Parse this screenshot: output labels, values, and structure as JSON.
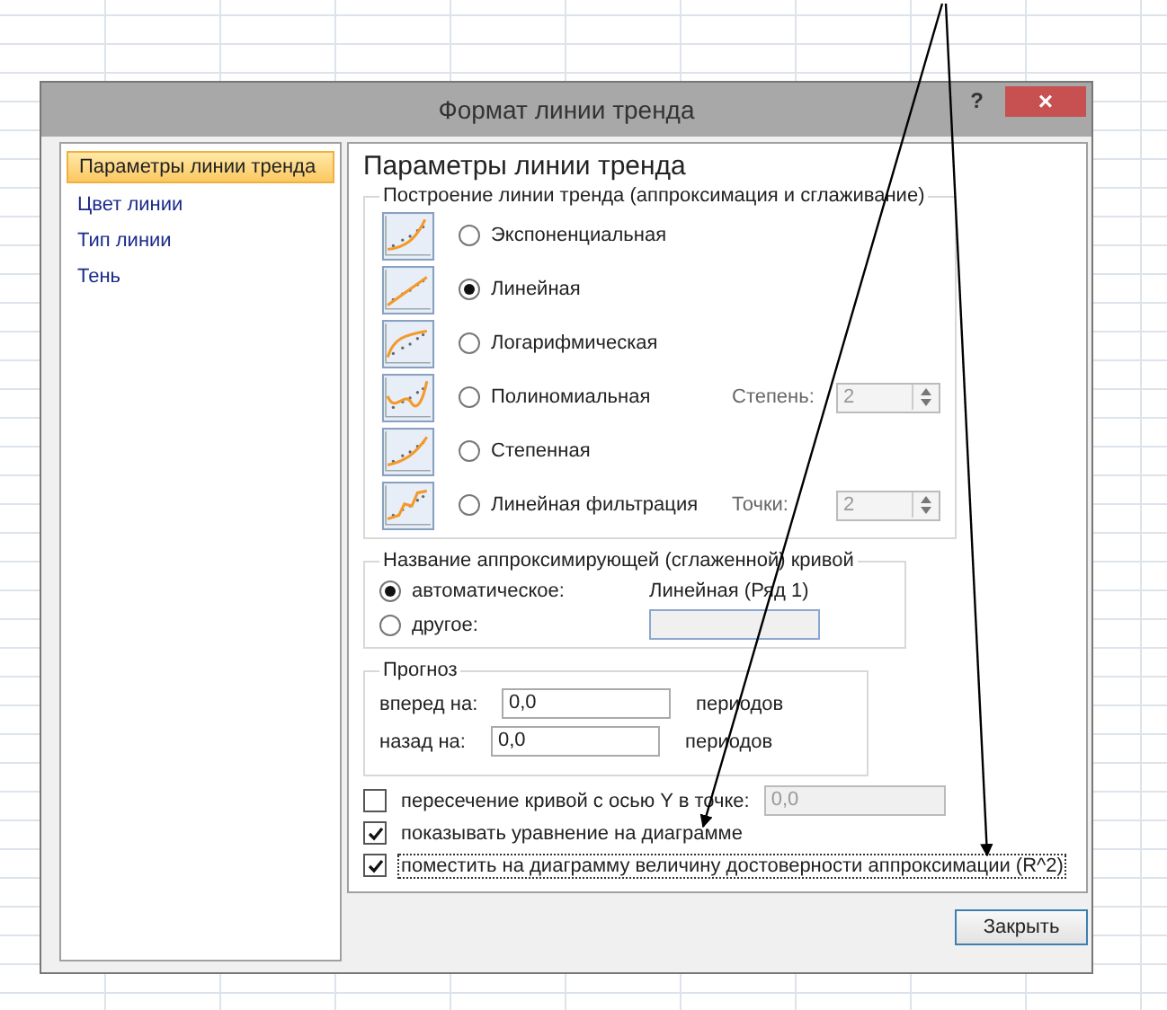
{
  "window": {
    "title": "Формат линии тренда",
    "help": "?",
    "close": "×"
  },
  "sidebar": {
    "items": [
      {
        "label": "Параметры линии тренда",
        "selected": true
      },
      {
        "label": "Цвет линии",
        "selected": false
      },
      {
        "label": "Тип линии",
        "selected": false
      },
      {
        "label": "Тень",
        "selected": false
      }
    ]
  },
  "heading": "Параметры линии тренда",
  "trend_group": {
    "title": "Построение линии тренда (аппроксимация и сглаживание)",
    "types": [
      {
        "kind": "exponential",
        "label": "Экспоненциальная",
        "selected": false
      },
      {
        "kind": "linear",
        "label": "Линейная",
        "selected": true
      },
      {
        "kind": "logarithmic",
        "label": "Логарифмическая",
        "selected": false
      },
      {
        "kind": "polynomial",
        "label": "Полиномиальная",
        "selected": false,
        "param_label": "Степень:",
        "param_value": "2"
      },
      {
        "kind": "power",
        "label": "Степенная",
        "selected": false
      },
      {
        "kind": "moving_average",
        "label": "Линейная фильтрация",
        "selected": false,
        "param_label": "Точки:",
        "param_value": "2"
      }
    ]
  },
  "name_group": {
    "title": "Название аппроксимирующей (сглаженной) кривой",
    "options": [
      {
        "label": "автоматическое:",
        "selected": true
      },
      {
        "label": "другое:",
        "selected": false
      }
    ],
    "auto_name": "Линейная (Ряд 1)"
  },
  "forecast": {
    "title": "Прогноз",
    "rows": [
      {
        "label": "вперед на:",
        "value": "0,0",
        "unit": "периодов"
      },
      {
        "label": "назад на:",
        "value": "0,0",
        "unit": "периодов"
      }
    ]
  },
  "options": [
    {
      "label": "пересечение кривой с осью Y в точке:",
      "checked": false,
      "value": "0,0",
      "disabled": true
    },
    {
      "label": "показывать уравнение на диаграмме",
      "checked": true
    },
    {
      "label": "поместить на диаграмму величину достоверности аппроксимации (R^2)",
      "checked": true,
      "focused": true
    }
  ],
  "close_button": "Закрыть"
}
